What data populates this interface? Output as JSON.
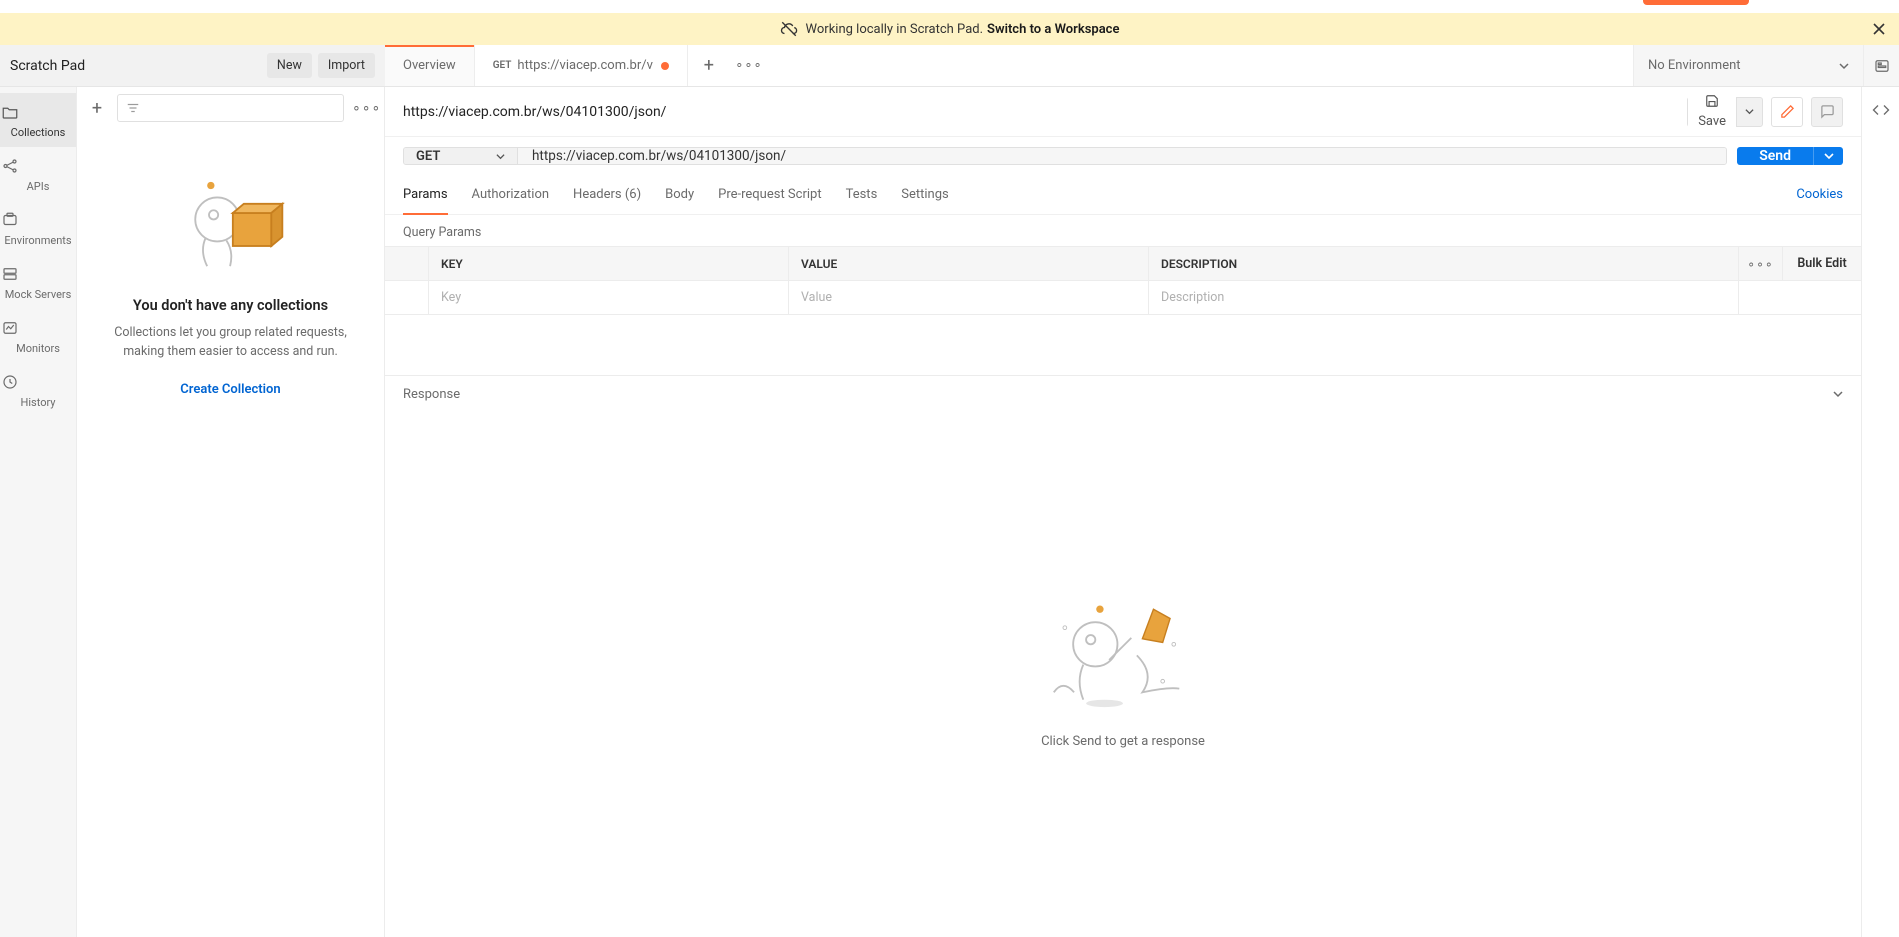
{
  "banner": {
    "msg1": "Working locally in Scratch Pad.",
    "msg2": "Switch to a Workspace"
  },
  "workspace": {
    "title": "Scratch Pad",
    "new_btn": "New",
    "import_btn": "Import"
  },
  "rail": {
    "items": [
      {
        "label": "Collections"
      },
      {
        "label": "APIs"
      },
      {
        "label": "Environments"
      },
      {
        "label": "Mock Servers"
      },
      {
        "label": "Monitors"
      },
      {
        "label": "History"
      }
    ]
  },
  "collections_empty": {
    "heading": "You don't have any collections",
    "text": "Collections let you group related requests, making them easier to access and run.",
    "cta": "Create Collection"
  },
  "tabs": {
    "overview": "Overview",
    "req_method": "GET",
    "req_label": "https://viacep.com.br/v"
  },
  "env": {
    "label": "No Environment"
  },
  "request": {
    "title": "https://viacep.com.br/ws/04101300/json/",
    "save": "Save",
    "method": "GET",
    "url": "https://viacep.com.br/ws/04101300/json/",
    "send": "Send",
    "tabs": {
      "params": "Params",
      "auth": "Authorization",
      "headers": "Headers (6)",
      "body": "Body",
      "prereq": "Pre-request Script",
      "tests": "Tests",
      "settings": "Settings",
      "cookies": "Cookies"
    },
    "query_params_label": "Query Params",
    "param_headers": {
      "key": "KEY",
      "value": "VALUE",
      "desc": "DESCRIPTION",
      "bulk": "Bulk Edit"
    },
    "param_placeholder": {
      "key": "Key",
      "value": "Value",
      "desc": "Description"
    }
  },
  "response": {
    "label": "Response",
    "empty": "Click Send to get a response"
  }
}
